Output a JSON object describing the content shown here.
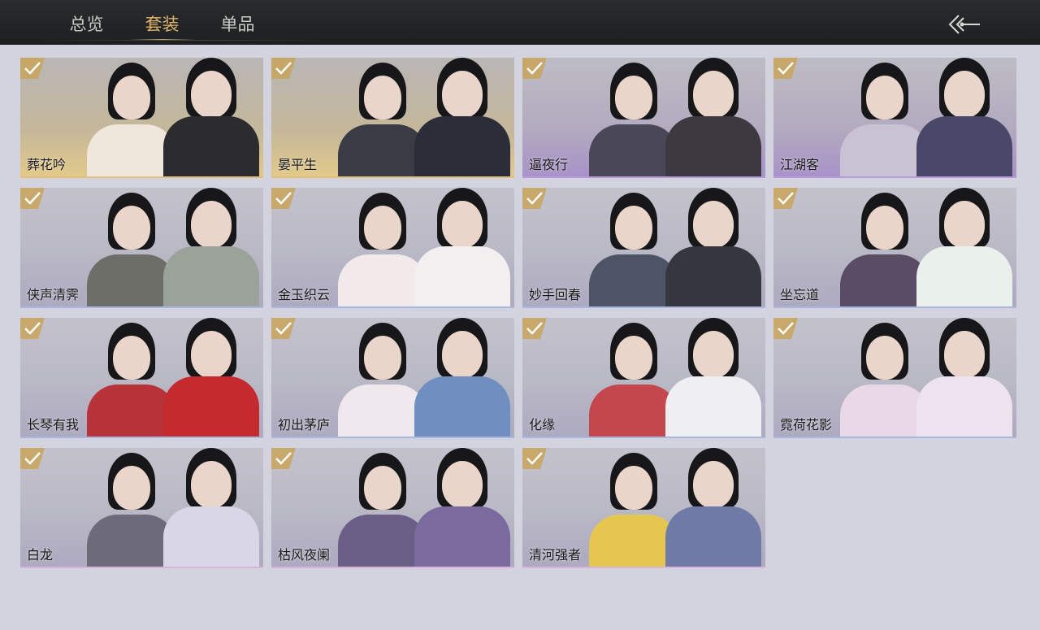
{
  "tabs": [
    "总览",
    "套装",
    "单品"
  ],
  "active_tab": "套装",
  "outfits": [
    {
      "name": "葬花吟",
      "tone": "gold"
    },
    {
      "name": "晏平生",
      "tone": "gold"
    },
    {
      "name": "逼夜行",
      "tone": "purple"
    },
    {
      "name": "江湖客",
      "tone": "purple"
    },
    {
      "name": "侠声清霁",
      "tone": "blue"
    },
    {
      "name": "金玉织云",
      "tone": "blue"
    },
    {
      "name": "妙手回春",
      "tone": "blue"
    },
    {
      "name": "坐忘道",
      "tone": "blue"
    },
    {
      "name": "长琴有我",
      "tone": "blue"
    },
    {
      "name": "初出茅庐",
      "tone": "blue"
    },
    {
      "name": "化缘",
      "tone": "blue"
    },
    {
      "name": "霓荷花影",
      "tone": "blue"
    },
    {
      "name": "白龙",
      "tone": "pink"
    },
    {
      "name": "枯风夜阑",
      "tone": "pink"
    },
    {
      "name": "清河强者",
      "tone": "pink"
    }
  ],
  "colors": {
    "accent": "#e0b36c",
    "check": "#c9a55a"
  }
}
